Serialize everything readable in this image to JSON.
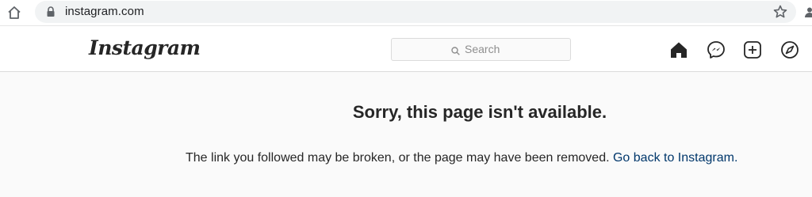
{
  "browser": {
    "url": "instagram.com",
    "icons": [
      "home-icon",
      "lock-icon",
      "star-icon",
      "profile-icon"
    ]
  },
  "header": {
    "logo_text": "Instagram",
    "search": {
      "placeholder": "Search"
    },
    "nav_icons": [
      "home-icon",
      "messenger-icon",
      "new-post-icon",
      "explore-icon"
    ]
  },
  "error": {
    "title": "Sorry, this page isn't available.",
    "message": "The link you followed may be broken, or the page may have been removed.",
    "link_text": "Go back to Instagram."
  },
  "colors": {
    "text": "#262626",
    "link": "#00376b",
    "page_background": "#fafafa",
    "border": "#dbdbdb",
    "placeholder": "#8e8e8e"
  }
}
